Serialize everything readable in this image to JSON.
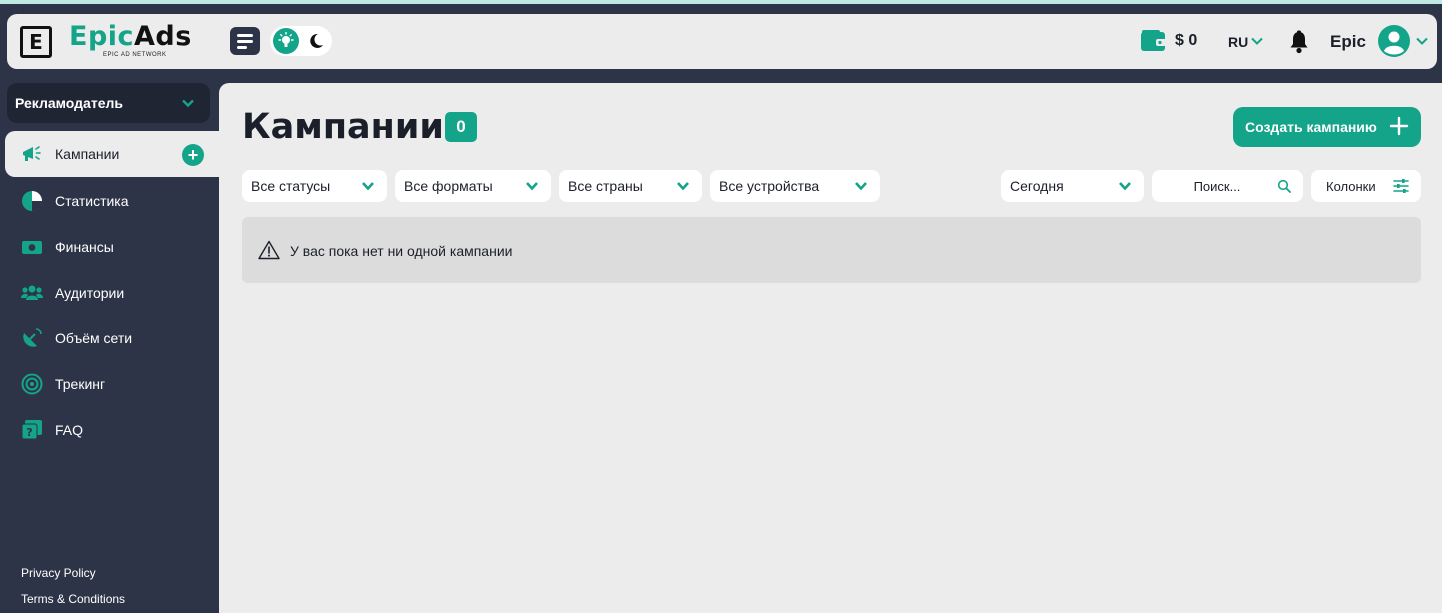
{
  "header": {
    "logo_letter": "E",
    "brand_part1": "Epic",
    "brand_part2": "Ads",
    "brand_tagline": "EPIC AD NETWORK",
    "balance": "$ 0",
    "language": "RU",
    "username": "Epic"
  },
  "sidebar": {
    "role": "Рекламодатель",
    "items": [
      {
        "label": "Кампании",
        "icon": "megaphone-icon",
        "active": true
      },
      {
        "label": "Статистика",
        "icon": "pie-chart-icon"
      },
      {
        "label": "Финансы",
        "icon": "money-icon"
      },
      {
        "label": "Аудитории",
        "icon": "users-icon"
      },
      {
        "label": "Объём сети",
        "icon": "satellite-dish-icon"
      },
      {
        "label": "Трекинг",
        "icon": "radar-icon"
      },
      {
        "label": "FAQ",
        "icon": "question-chat-icon"
      }
    ],
    "footer_links": [
      "Privacy Policy",
      "Terms & Conditions"
    ]
  },
  "main": {
    "title": "Кампании",
    "count": "0",
    "create_button": "Создать кампанию",
    "filters": {
      "status": "Все статусы",
      "format": "Все форматы",
      "country": "Все страны",
      "device": "Все устройства",
      "period": "Сегодня"
    },
    "search_placeholder": "Поиск...",
    "columns_button": "Колонки",
    "empty_message": "У вас пока нет ни одной кампании"
  },
  "colors": {
    "accent": "#13a489",
    "sidebar_bg": "#2e3447",
    "content_bg": "#ececec"
  }
}
